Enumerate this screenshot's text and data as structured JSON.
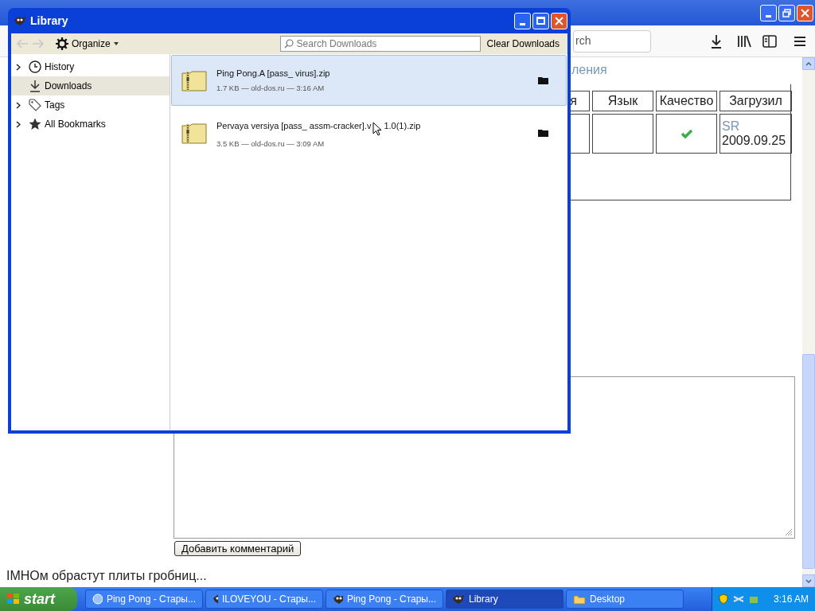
{
  "browser": {
    "search_value": "rch",
    "heading_fragment": "ления",
    "table": {
      "columns": [
        "я",
        "Язык",
        "Качество",
        "Загрузил"
      ],
      "rows": [
        {
          "cells": [
            {
              "kind": "text",
              "text": ""
            },
            {
              "kind": "text",
              "text": ""
            },
            {
              "kind": "check"
            },
            {
              "kind": "uploader",
              "user": "SR",
              "date": "2009.09.25"
            }
          ]
        }
      ]
    },
    "comment_button": "Добавить комментарий",
    "comment_text": "IMHOм обрастут плиты гробниц..."
  },
  "library": {
    "title": "Library",
    "organize": "Organize",
    "search_placeholder": "Search Downloads",
    "clear_button": "Clear Downloads",
    "sidebar": [
      {
        "label": "History",
        "kind": "clock",
        "expandable": true,
        "selected": false
      },
      {
        "label": "Downloads",
        "kind": "download",
        "expandable": false,
        "selected": true
      },
      {
        "label": "Tags",
        "kind": "tag",
        "expandable": true,
        "selected": false
      },
      {
        "label": "All Bookmarks",
        "kind": "star",
        "expandable": true,
        "selected": false
      }
    ],
    "downloads": [
      {
        "name": "Ping Pong.A [pass_ virus].zip",
        "details": "1.7 KB — old-dos.ru — 3:16 AM",
        "selected": true
      },
      {
        "name": "Pervaya versiya [pass_ assm-cracker].v",
        "name_tail": "1.0(1).zip",
        "details": "3.5 KB — old-dos.ru — 3:09 AM",
        "selected": false
      }
    ]
  },
  "taskbar": {
    "start": "start",
    "tasks": [
      {
        "label": "Ping Pong - Стары...",
        "kind": "globe",
        "selected": false
      },
      {
        "label": "ILOVEYOU - Стары...",
        "kind": "app",
        "selected": false
      },
      {
        "label": "Ping Pong - Стары...",
        "kind": "app",
        "selected": false
      },
      {
        "label": "Library",
        "kind": "app",
        "selected": true
      },
      {
        "label": "Desktop",
        "kind": "folder",
        "selected": false
      }
    ],
    "clock": "3:16 AM"
  }
}
